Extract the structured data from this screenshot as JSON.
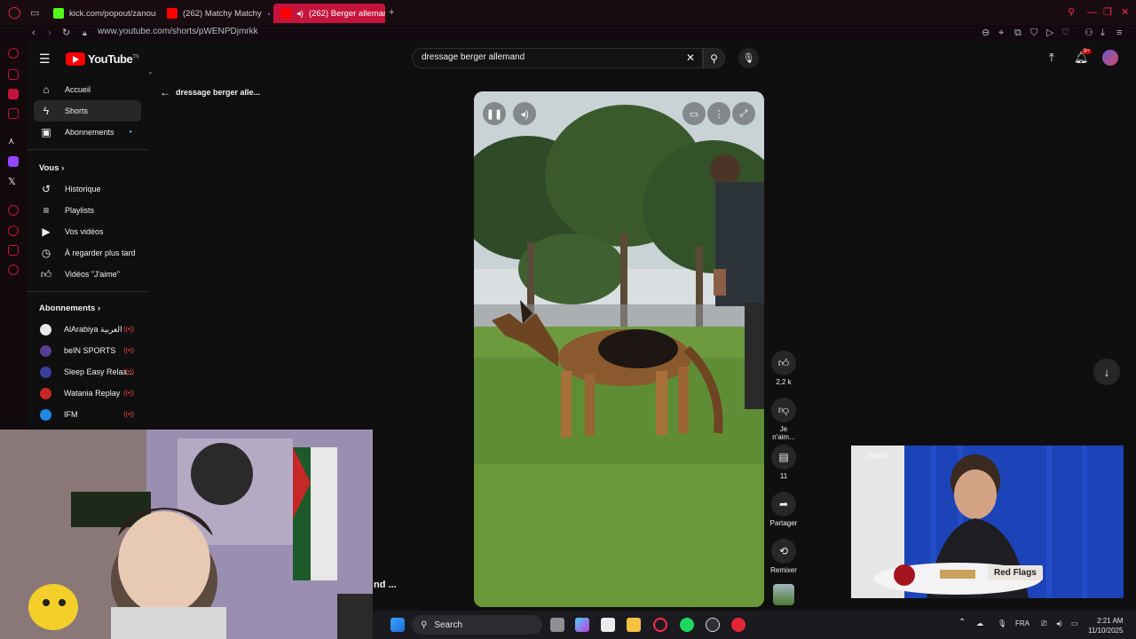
{
  "browser": {
    "tabs": [
      {
        "label": "kick.com/popout/zanoun..."
      },
      {
        "label": "(262) Matchy Matchy"
      },
      {
        "label": "(262) Berger allemand"
      }
    ],
    "url": "www.youtube.com/shorts/pWENPDjmrkk"
  },
  "youtube": {
    "logo_text": "YouTube",
    "logo_sup": "TN",
    "search": {
      "value": "dressage berger allemand"
    },
    "notification_count": "9+",
    "back_label": "dressage berger alle...",
    "nav": [
      {
        "label": "Accueil",
        "icon": "home-icon"
      },
      {
        "label": "Shorts",
        "icon": "shorts-icon"
      },
      {
        "label": "Abonnements",
        "icon": "subscriptions-icon"
      }
    ],
    "you_title": "Vous",
    "you_items": [
      {
        "label": "Historique",
        "icon": "history-icon"
      },
      {
        "label": "Playlists",
        "icon": "playlists-icon"
      },
      {
        "label": "Vos vidéos",
        "icon": "your-videos-icon"
      },
      {
        "label": "À regarder plus tard",
        "icon": "watch-later-icon"
      },
      {
        "label": "Vidéos \"J'aime\"",
        "icon": "liked-icon"
      }
    ],
    "subs_title": "Abonnements",
    "subs": [
      {
        "label": "AlArabiya العربية",
        "color": "#e8e8e8"
      },
      {
        "label": "beIN SPORTS",
        "color": "#5a3d8f"
      },
      {
        "label": "Sleep Easy Relax...",
        "color": "#3b3f9a"
      },
      {
        "label": "Watania Replay",
        "color": "#c62828"
      },
      {
        "label": "IFM",
        "color": "#1e88e5"
      }
    ],
    "actions": {
      "likes": "2,2 k",
      "dislike_label": "Je n'aim...",
      "comments": "11",
      "share_label": "Partager",
      "remix_label": "Remixer"
    },
    "overlay_text": "nd ..."
  },
  "stream": {
    "clip_badge": "Red Flags",
    "clip_brand": "match"
  },
  "taskbar": {
    "search_placeholder": "Search",
    "lang": "FRA",
    "time": "2:21 AM",
    "date": "11/10/2025"
  },
  "colors": {
    "opera_accent": "#c4143c",
    "yt_red": "#ff0000"
  }
}
